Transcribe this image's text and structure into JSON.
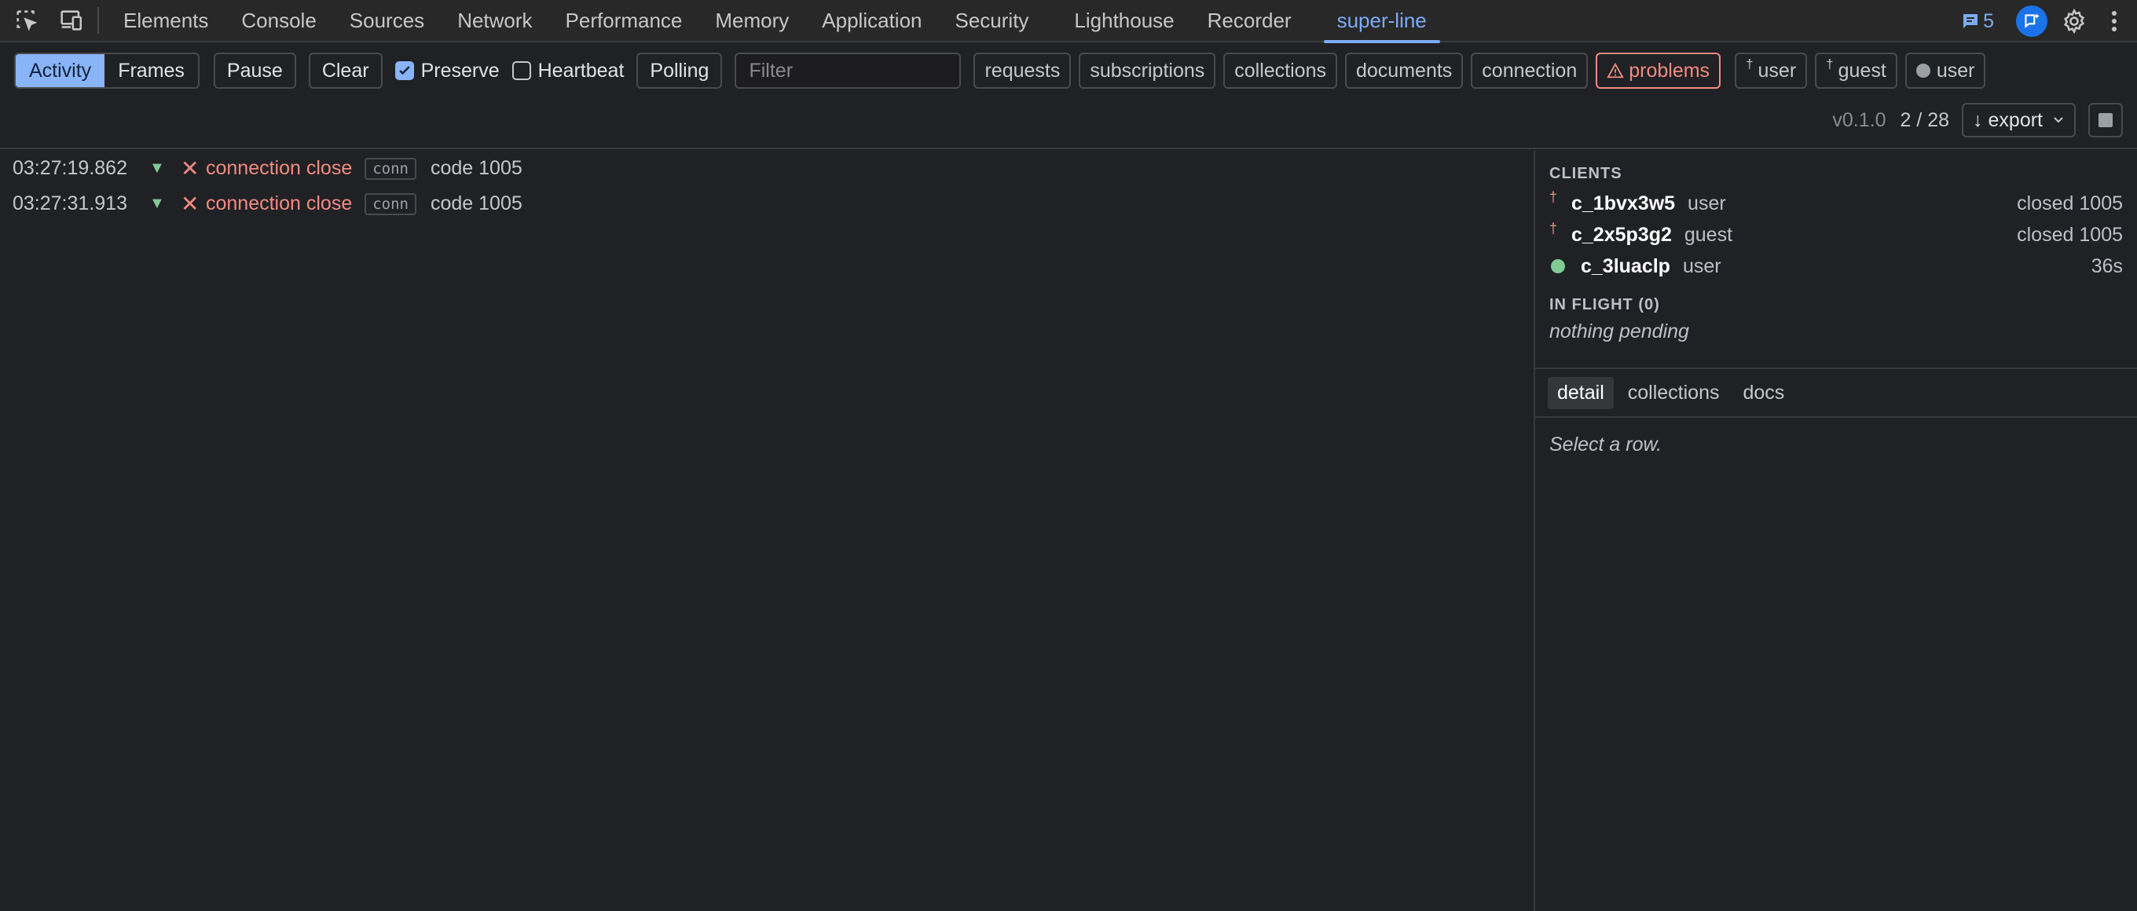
{
  "devtools": {
    "tabs": [
      "Elements",
      "Console",
      "Sources",
      "Network",
      "Performance",
      "Memory",
      "Application",
      "Security",
      "Lighthouse",
      "Recorder",
      "super-line"
    ],
    "active_tab": "super-line",
    "issues_count": "5"
  },
  "toolbar": {
    "view_tabs": [
      "Activity",
      "Frames"
    ],
    "pause_label": "Pause",
    "clear_label": "Clear",
    "preserve_label": "Preserve",
    "preserve_checked": true,
    "heartbeat_label": "Heartbeat",
    "heartbeat_checked": false,
    "polling_label": "Polling",
    "filter_placeholder": "Filter",
    "chips": [
      "requests",
      "subscriptions",
      "collections",
      "documents",
      "connection"
    ],
    "problems_label": "problems",
    "client_chips": [
      {
        "mark": "†",
        "label": "user"
      },
      {
        "mark": "†",
        "label": "guest"
      },
      {
        "mark": "●",
        "label": "user"
      }
    ],
    "version": "v0.1.0",
    "count": "2 / 28",
    "export_label": "↓ export"
  },
  "log": [
    {
      "time": "03:27:19.862",
      "event": "connection close",
      "tag": "conn",
      "detail": "code 1005"
    },
    {
      "time": "03:27:31.913",
      "event": "connection close",
      "tag": "conn",
      "detail": "code 1005"
    }
  ],
  "sidebar": {
    "clients_title": "CLIENTS",
    "clients": [
      {
        "mark": "†",
        "id": "c_1bvx3w5",
        "role": "user",
        "status": "closed 1005"
      },
      {
        "mark": "†",
        "id": "c_2x5p3g2",
        "role": "guest",
        "status": "closed 1005"
      },
      {
        "mark": "●",
        "id": "c_3luaclp",
        "role": "user",
        "status": "36s"
      }
    ],
    "inflight_title": "IN FLIGHT (0)",
    "inflight_empty": "nothing pending",
    "tabs": [
      "detail",
      "collections",
      "docs"
    ],
    "active_tab": "detail",
    "detail_empty": "Select a row."
  },
  "colors": {
    "accent": "#8ab4f8",
    "error": "#f28b82",
    "ok": "#81c995",
    "background": "#202124"
  }
}
